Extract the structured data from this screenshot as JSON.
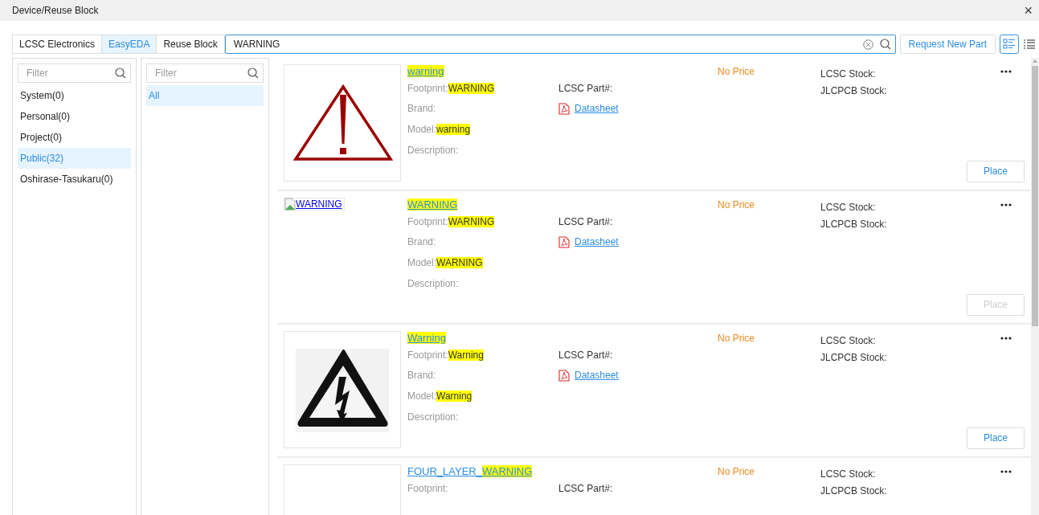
{
  "window": {
    "title": "Device/Reuse Block",
    "close": "×"
  },
  "tabs": [
    {
      "label": "LCSC Electronics",
      "selected": false
    },
    {
      "label": "EasyEDA",
      "selected": true
    },
    {
      "label": "Reuse Block",
      "selected": false
    }
  ],
  "search": {
    "value": "WARNING"
  },
  "request_button": "Request New Part",
  "view_modes": [
    {
      "kind": "detail",
      "selected": true
    },
    {
      "kind": "list",
      "selected": false
    }
  ],
  "libraries": {
    "filter": {
      "placeholder": "Filter"
    },
    "items": [
      {
        "label": "System(0)",
        "selected": false
      },
      {
        "label": "Personal(0)",
        "selected": false
      },
      {
        "label": "Project(0)",
        "selected": false
      },
      {
        "label": "Public(32)",
        "selected": true
      },
      {
        "label": "Oshirase-Tasukaru(0)",
        "selected": false
      }
    ]
  },
  "categories": {
    "filter": {
      "placeholder": "Filter"
    },
    "items": [
      {
        "label": "All",
        "selected": true
      }
    ]
  },
  "parts": [
    {
      "image": {
        "kind": "exclamation"
      },
      "title": [
        {
          "text": "warning",
          "highlight": true
        }
      ],
      "footprint_label": "Footprint:",
      "footprint": "WARNING",
      "brand_label": "Brand:",
      "model_label": "Model:",
      "model": "warning",
      "description_label": "Description:",
      "lcsc_part_label": "LCSC Part#:",
      "datasheet": "Datasheet",
      "price": "No Price",
      "lcsc_stock_label": "LCSC Stock:",
      "jlcpcb_stock_label": "JLCPCB Stock:",
      "place": {
        "label": "Place",
        "disabled": false
      }
    },
    {
      "image": {
        "kind": "broken",
        "alt": "WARNING"
      },
      "title": [
        {
          "text": "WARNING",
          "highlight": true
        }
      ],
      "footprint_label": "Footprint:",
      "footprint": "WARNING",
      "brand_label": "Brand:",
      "model_label": "Model:",
      "model": "WARNING",
      "description_label": "Description:",
      "lcsc_part_label": "LCSC Part#:",
      "datasheet": "Datasheet",
      "price": "No Price",
      "lcsc_stock_label": "LCSC Stock:",
      "jlcpcb_stock_label": "JLCPCB Stock:",
      "place": {
        "label": "Place",
        "disabled": true
      }
    },
    {
      "image": {
        "kind": "lightning"
      },
      "title": [
        {
          "text": "Warning",
          "highlight": true
        }
      ],
      "footprint_label": "Footprint:",
      "footprint": "Warning",
      "brand_label": "Brand:",
      "model_label": "Model:",
      "model": "Warning",
      "description_label": "Description:",
      "lcsc_part_label": "LCSC Part#:",
      "datasheet": "Datasheet",
      "price": "No Price",
      "lcsc_stock_label": "LCSC Stock:",
      "jlcpcb_stock_label": "JLCPCB Stock:",
      "place": {
        "label": "Place",
        "disabled": false
      }
    },
    {
      "image": {
        "kind": "empty"
      },
      "title": [
        {
          "text": "FOUR_LAYER_",
          "highlight": false
        },
        {
          "text": "WARNING",
          "highlight": true
        }
      ],
      "footprint_label": "Footprint:",
      "lcsc_part_label": "LCSC Part#:",
      "price": "No Price",
      "lcsc_stock_label": "LCSC Stock:",
      "jlcpcb_stock_label": "JLCPCB Stock:"
    }
  ]
}
